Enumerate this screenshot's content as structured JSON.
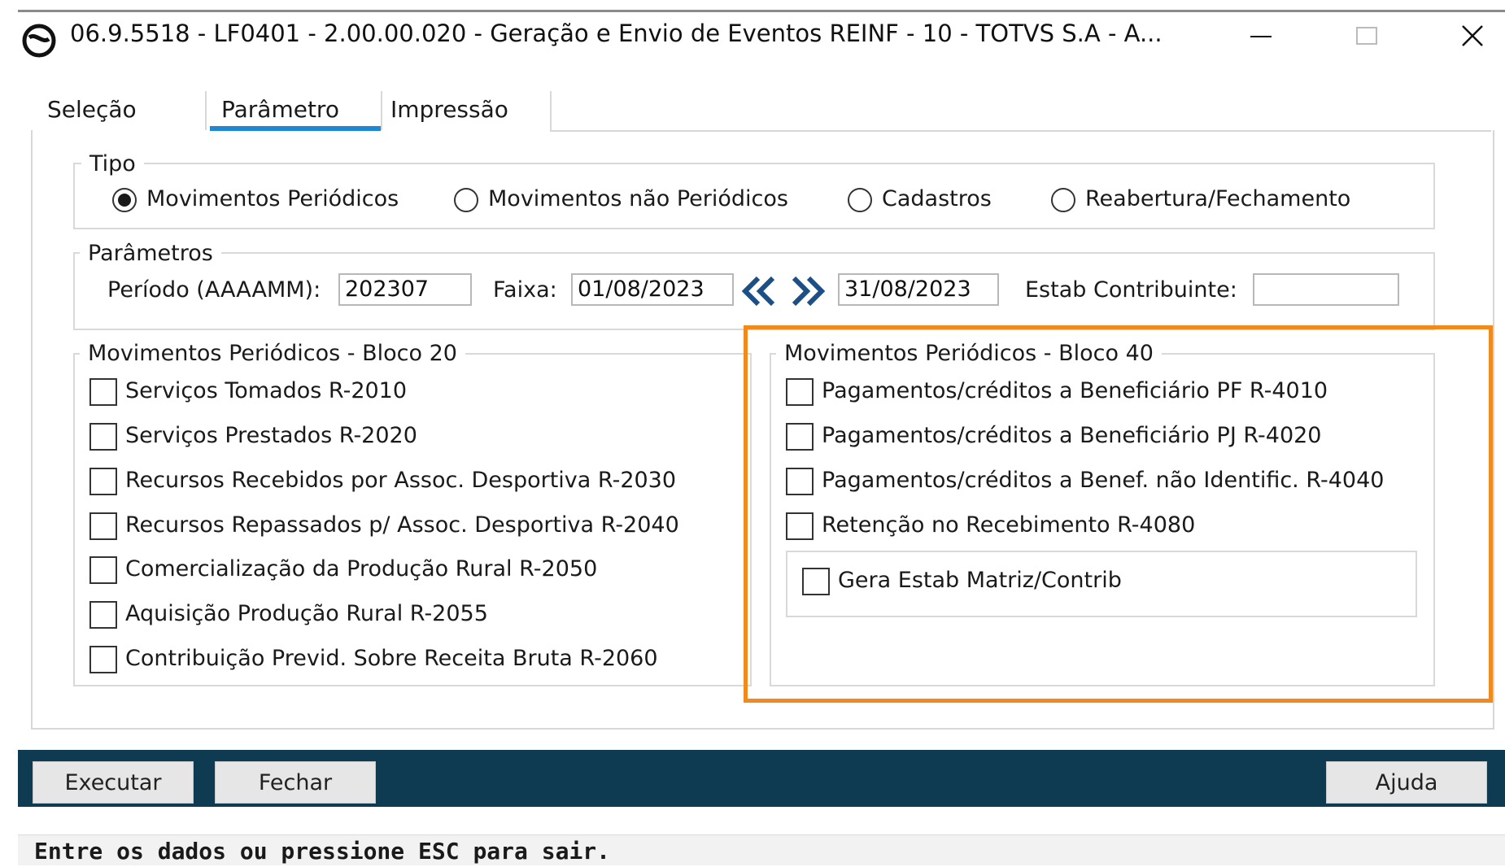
{
  "window": {
    "title": "06.9.5518 - LF0401 - 2.00.00.020 - Geração e Envio de Eventos REINF - 10 - TOTVS S.A - A..."
  },
  "tabs": [
    {
      "label": "Seleção"
    },
    {
      "label": "Parâmetro",
      "active": true
    },
    {
      "label": "Impressão"
    }
  ],
  "tipo": {
    "legend": "Tipo",
    "options": [
      {
        "label": "Movimentos Periódicos",
        "selected": true
      },
      {
        "label": "Movimentos não Periódicos",
        "selected": false
      },
      {
        "label": "Cadastros",
        "selected": false
      },
      {
        "label": "Reabertura/Fechamento",
        "selected": false
      }
    ]
  },
  "parametros": {
    "legend": "Parâmetros",
    "periodo_label": "Período (AAAAMM):",
    "periodo_value": "202307",
    "faixa_label": "Faixa:",
    "faixa_inicio": "01/08/2023",
    "faixa_fim": "31/08/2023",
    "estab_label": "Estab Contribuinte:",
    "estab_value": ""
  },
  "bloco20": {
    "legend": "Movimentos Periódicos - Bloco 20",
    "items": [
      {
        "label": "Serviços Tomados R-2010",
        "checked": false
      },
      {
        "label": "Serviços Prestados R-2020",
        "checked": false
      },
      {
        "label": "Recursos Recebidos por Assoc. Desportiva R-2030",
        "checked": false
      },
      {
        "label": "Recursos Repassados p/ Assoc. Desportiva R-2040",
        "checked": false
      },
      {
        "label": "Comercialização da Produção Rural R-2050",
        "checked": false
      },
      {
        "label": "Aquisição Produção Rural R-2055",
        "checked": false
      },
      {
        "label": "Contribuição Previd. Sobre Receita Bruta R-2060",
        "checked": false
      }
    ]
  },
  "bloco40": {
    "legend": "Movimentos Periódicos - Bloco 40",
    "items": [
      {
        "label": "Pagamentos/créditos a Beneficiário PF R-4010",
        "checked": false
      },
      {
        "label": "Pagamentos/créditos a Beneficiário PJ R-4020",
        "checked": false
      },
      {
        "label": "Pagamentos/créditos a Benef. não Identific. R-4040",
        "checked": false
      },
      {
        "label": "Retenção no Recebimento R-4080",
        "checked": false
      }
    ],
    "gera_estab_label": "Gera Estab Matriz/Contrib"
  },
  "buttons": {
    "executar": "Executar",
    "fechar": "Fechar",
    "ajuda": "Ajuda"
  },
  "status": "Entre os dados ou pressione ESC para sair.",
  "colors": {
    "accent_tab": "#1e88d6",
    "highlight": "#f08a1c",
    "bottom_bar": "#0e3a52"
  }
}
